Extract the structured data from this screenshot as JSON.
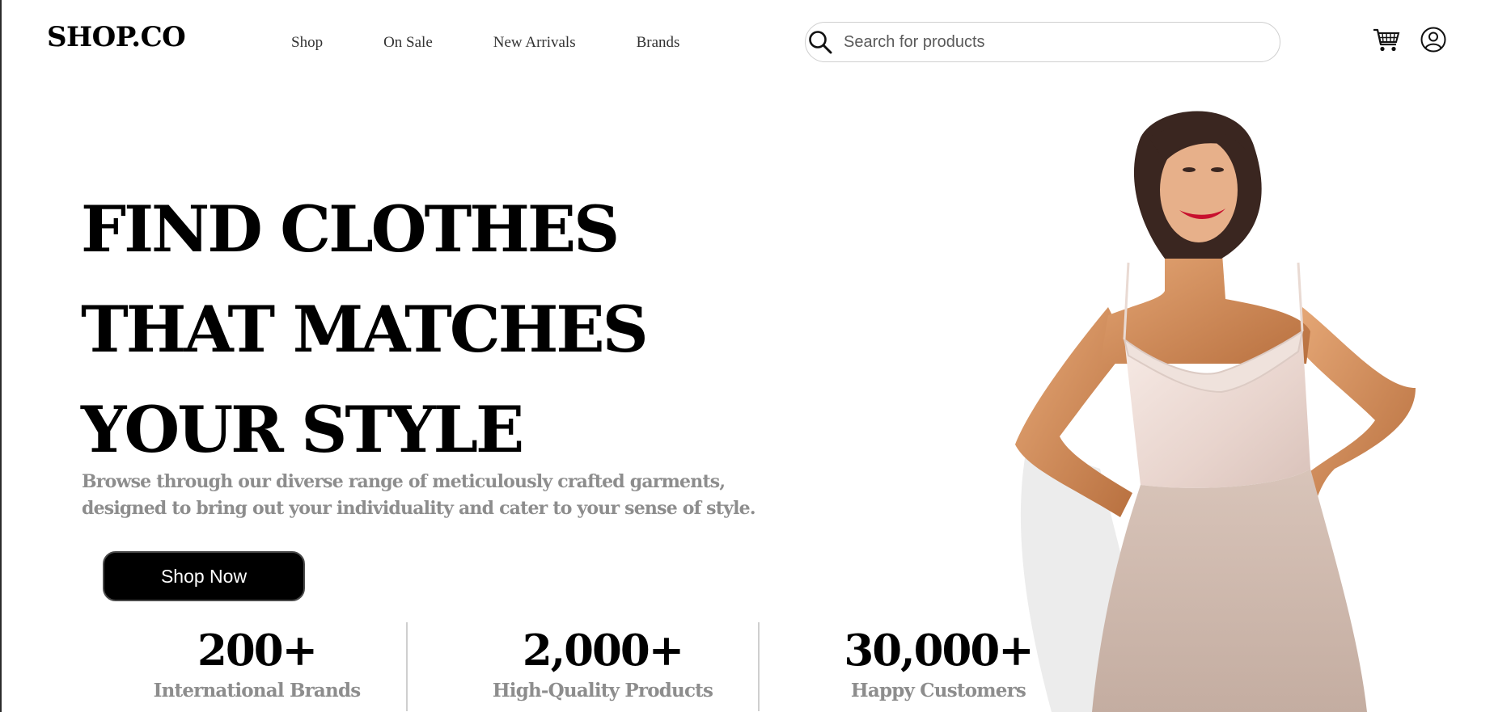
{
  "header": {
    "logo": "SHOP.CO",
    "nav": [
      "Shop",
      "On Sale",
      "New Arrivals",
      "Brands"
    ],
    "search_placeholder": "Search for products"
  },
  "hero": {
    "headline_lines": [
      "FIND CLOTHES",
      "THAT MATCHES",
      "YOUR STYLE"
    ],
    "subtext_lines": [
      "Browse through our diverse range of meticulously crafted garments,",
      "designed to bring out your individuality and cater to your sense of style."
    ],
    "cta_label": "Shop Now",
    "stats": [
      {
        "number": "200+",
        "label": "International Brands"
      },
      {
        "number": "2,000+",
        "label": "High-Quality Products"
      },
      {
        "number": "30,000+",
        "label": "Happy Customers"
      }
    ]
  },
  "colors": {
    "text": "#000000",
    "muted": "#8d8d8d",
    "button_bg": "#000000",
    "button_text": "#ffffff"
  },
  "icons": [
    "search-icon",
    "cart-icon",
    "user-icon"
  ]
}
